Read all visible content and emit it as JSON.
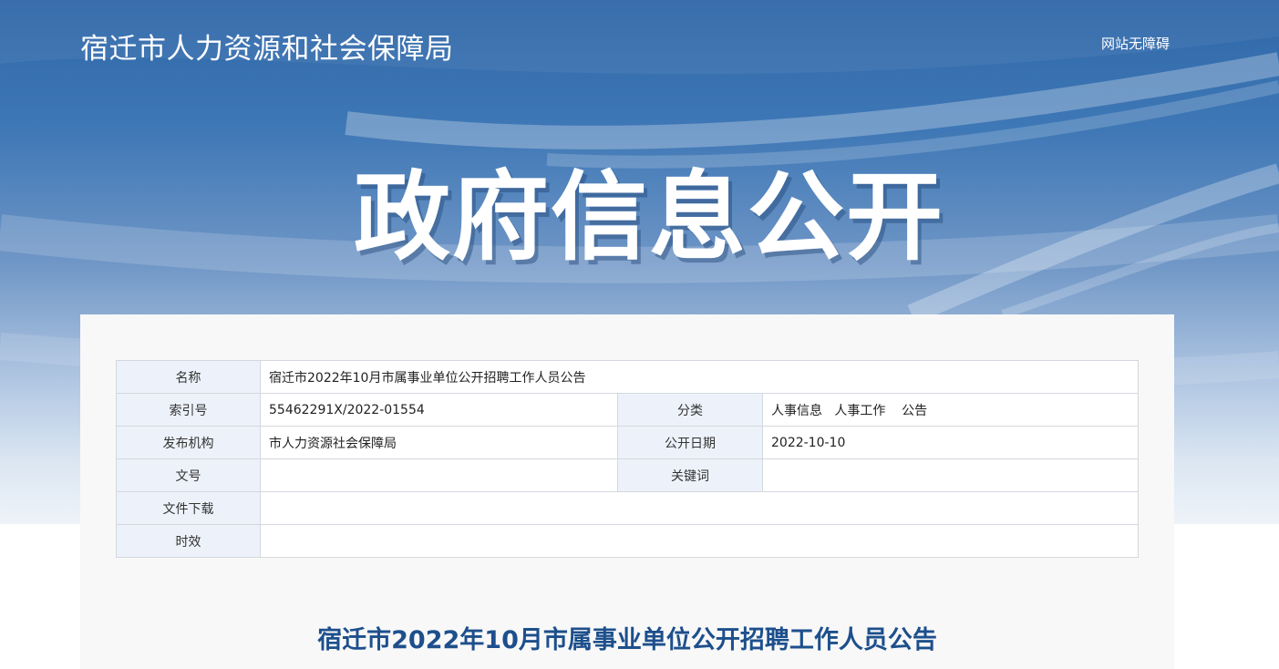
{
  "header": {
    "site_title": "宿迁市人力资源和社会保障局",
    "accessibility_link": "网站无障碍"
  },
  "banner": {
    "title": "政府信息公开"
  },
  "meta_table": {
    "name_label": "名称",
    "name_value": "宿迁市2022年10月市属事业单位公开招聘工作人员公告",
    "index_label": "索引号",
    "index_value": "55462291X/2022-01554",
    "category_label": "分类",
    "category_value": "人事信息   人事工作    公告",
    "publisher_label": "发布机构",
    "publisher_value": "市人力资源社会保障局",
    "date_label": "公开日期",
    "date_value": "2022-10-10",
    "doc_no_label": "文号",
    "doc_no_value": "",
    "keywords_label": "关键词",
    "keywords_value": "",
    "download_label": "文件下载",
    "download_value": "",
    "validity_label": "时效",
    "validity_value": ""
  },
  "article": {
    "title": "宿迁市2022年10月市属事业单位公开招聘工作人员公告"
  },
  "colors": {
    "banner_blue": "#2f67a8",
    "title_blue": "#1d4f8c",
    "label_bg": "#edf2fa"
  }
}
